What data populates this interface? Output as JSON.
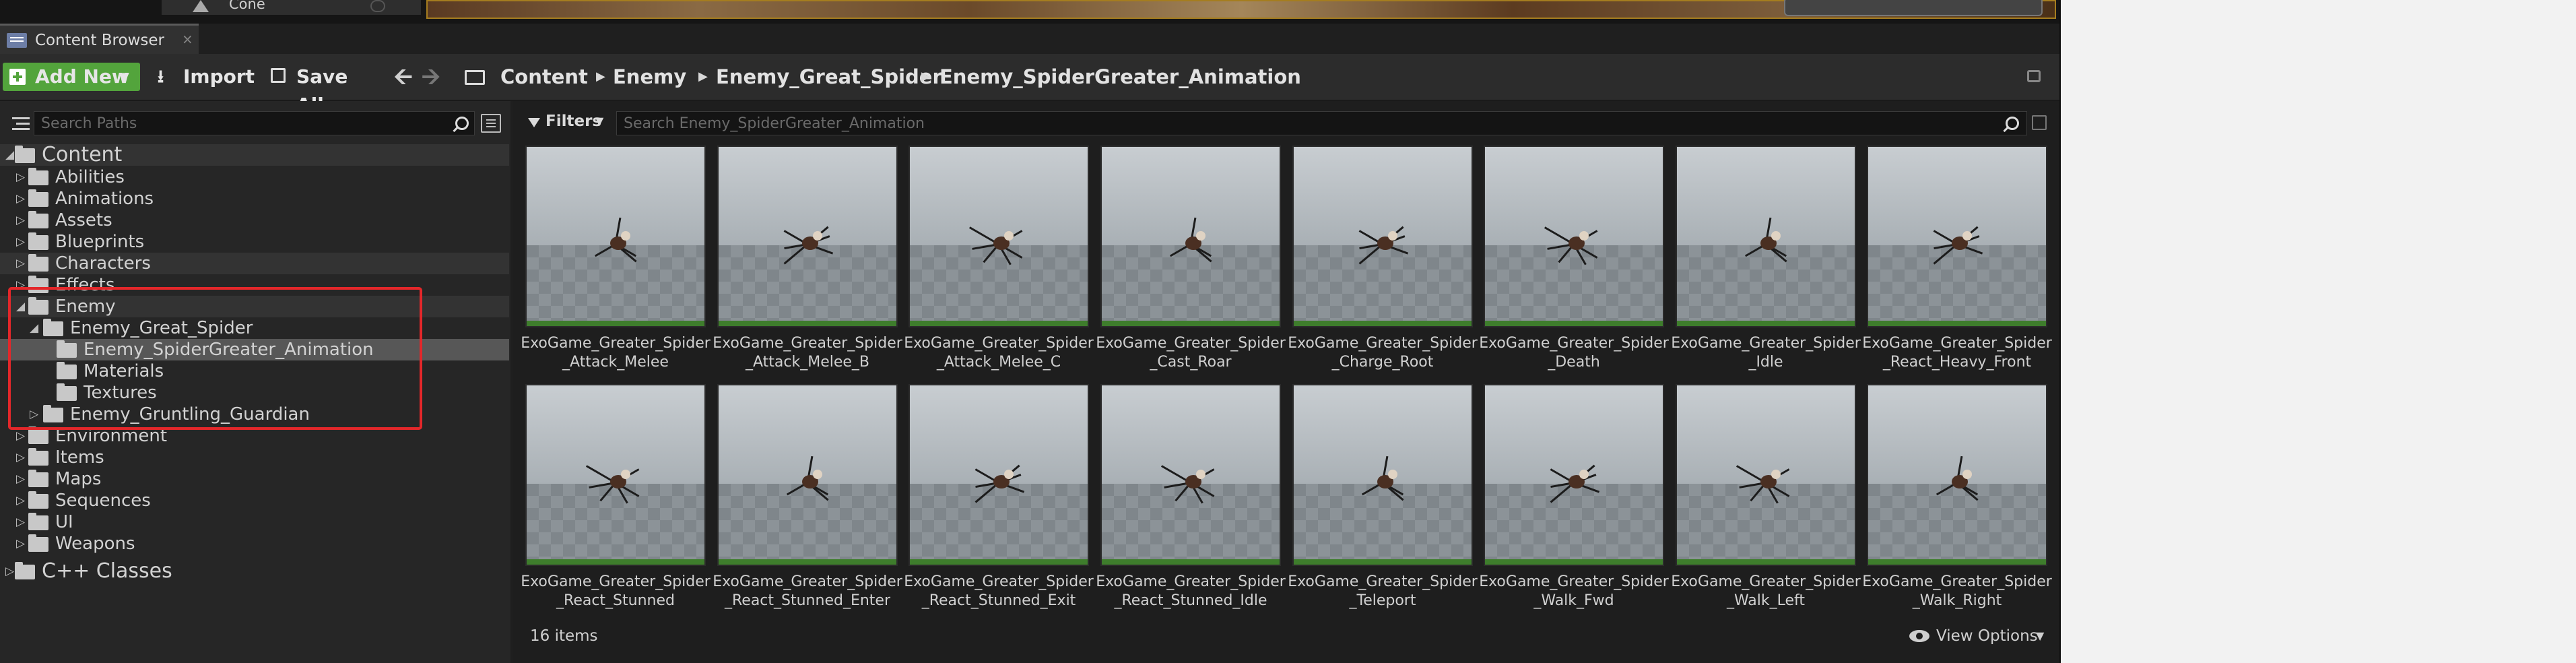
{
  "outliner": {
    "row_label": "Cone"
  },
  "tab": {
    "title": "Content Browser",
    "close": "×"
  },
  "toolbar": {
    "add_new": "Add New",
    "import": "Import",
    "save_all": "Save All",
    "back": "🡨",
    "forward": "🡪"
  },
  "breadcrumb": {
    "items": [
      "Content",
      "Enemy",
      "Enemy_Great_Spider",
      "Enemy_SpiderGreater_Animation"
    ]
  },
  "paths": {
    "search_placeholder": "Search Paths",
    "tree": [
      {
        "label": "Content",
        "depth": 0,
        "expanded": true
      },
      {
        "label": "Abilities",
        "depth": 1
      },
      {
        "label": "Animations",
        "depth": 1
      },
      {
        "label": "Assets",
        "depth": 1
      },
      {
        "label": "Blueprints",
        "depth": 1
      },
      {
        "label": "Characters",
        "depth": 1
      },
      {
        "label": "Effects",
        "depth": 1
      },
      {
        "label": "Enemy",
        "depth": 1,
        "expanded": true
      },
      {
        "label": "Enemy_Great_Spider",
        "depth": 2,
        "expanded": true
      },
      {
        "label": "Enemy_SpiderGreater_Animation",
        "depth": 3,
        "selected": true
      },
      {
        "label": "Materials",
        "depth": 3
      },
      {
        "label": "Textures",
        "depth": 3
      },
      {
        "label": "Enemy_Gruntling_Guardian",
        "depth": 2
      },
      {
        "label": "Environment",
        "depth": 1
      },
      {
        "label": "Items",
        "depth": 1
      },
      {
        "label": "Maps",
        "depth": 1
      },
      {
        "label": "Sequences",
        "depth": 1
      },
      {
        "label": "UI",
        "depth": 1
      },
      {
        "label": "Weapons",
        "depth": 1
      },
      {
        "label": "C++ Classes",
        "depth": 0
      }
    ]
  },
  "assets": {
    "filters_label": "Filters",
    "search_placeholder": "Search Enemy_SpiderGreater_Animation",
    "items": [
      [
        "ExoGame_Greater_Spider",
        "_Attack_Melee"
      ],
      [
        "ExoGame_Greater_Spider",
        "_Attack_Melee_B"
      ],
      [
        "ExoGame_Greater_Spider",
        "_Attack_Melee_C"
      ],
      [
        "ExoGame_Greater_Spider",
        "_Cast_Roar"
      ],
      [
        "ExoGame_Greater_Spider",
        "_Charge_Root"
      ],
      [
        "ExoGame_Greater_Spider",
        "_Death"
      ],
      [
        "ExoGame_Greater_Spider",
        "_Idle"
      ],
      [
        "ExoGame_Greater_Spider",
        "_React_Heavy_Front"
      ],
      [
        "ExoGame_Greater_Spider",
        "_React_Stunned"
      ],
      [
        "ExoGame_Greater_Spider",
        "_React_Stunned_Enter"
      ],
      [
        "ExoGame_Greater_Spider",
        "_React_Stunned_Exit"
      ],
      [
        "ExoGame_Greater_Spider",
        "_React_Stunned_Idle"
      ],
      [
        "ExoGame_Greater_Spider",
        "_Teleport"
      ],
      [
        "ExoGame_Greater_Spider",
        "_Walk_Fwd"
      ],
      [
        "ExoGame_Greater_Spider",
        "_Walk_Left"
      ],
      [
        "ExoGame_Greater_Spider",
        "_Walk_Right"
      ]
    ],
    "item_count": "16 items",
    "view_options": "View Options"
  },
  "colors": {
    "accent_green": "#53a43c",
    "highlight_red": "#e3272a",
    "selection": "#575757"
  }
}
